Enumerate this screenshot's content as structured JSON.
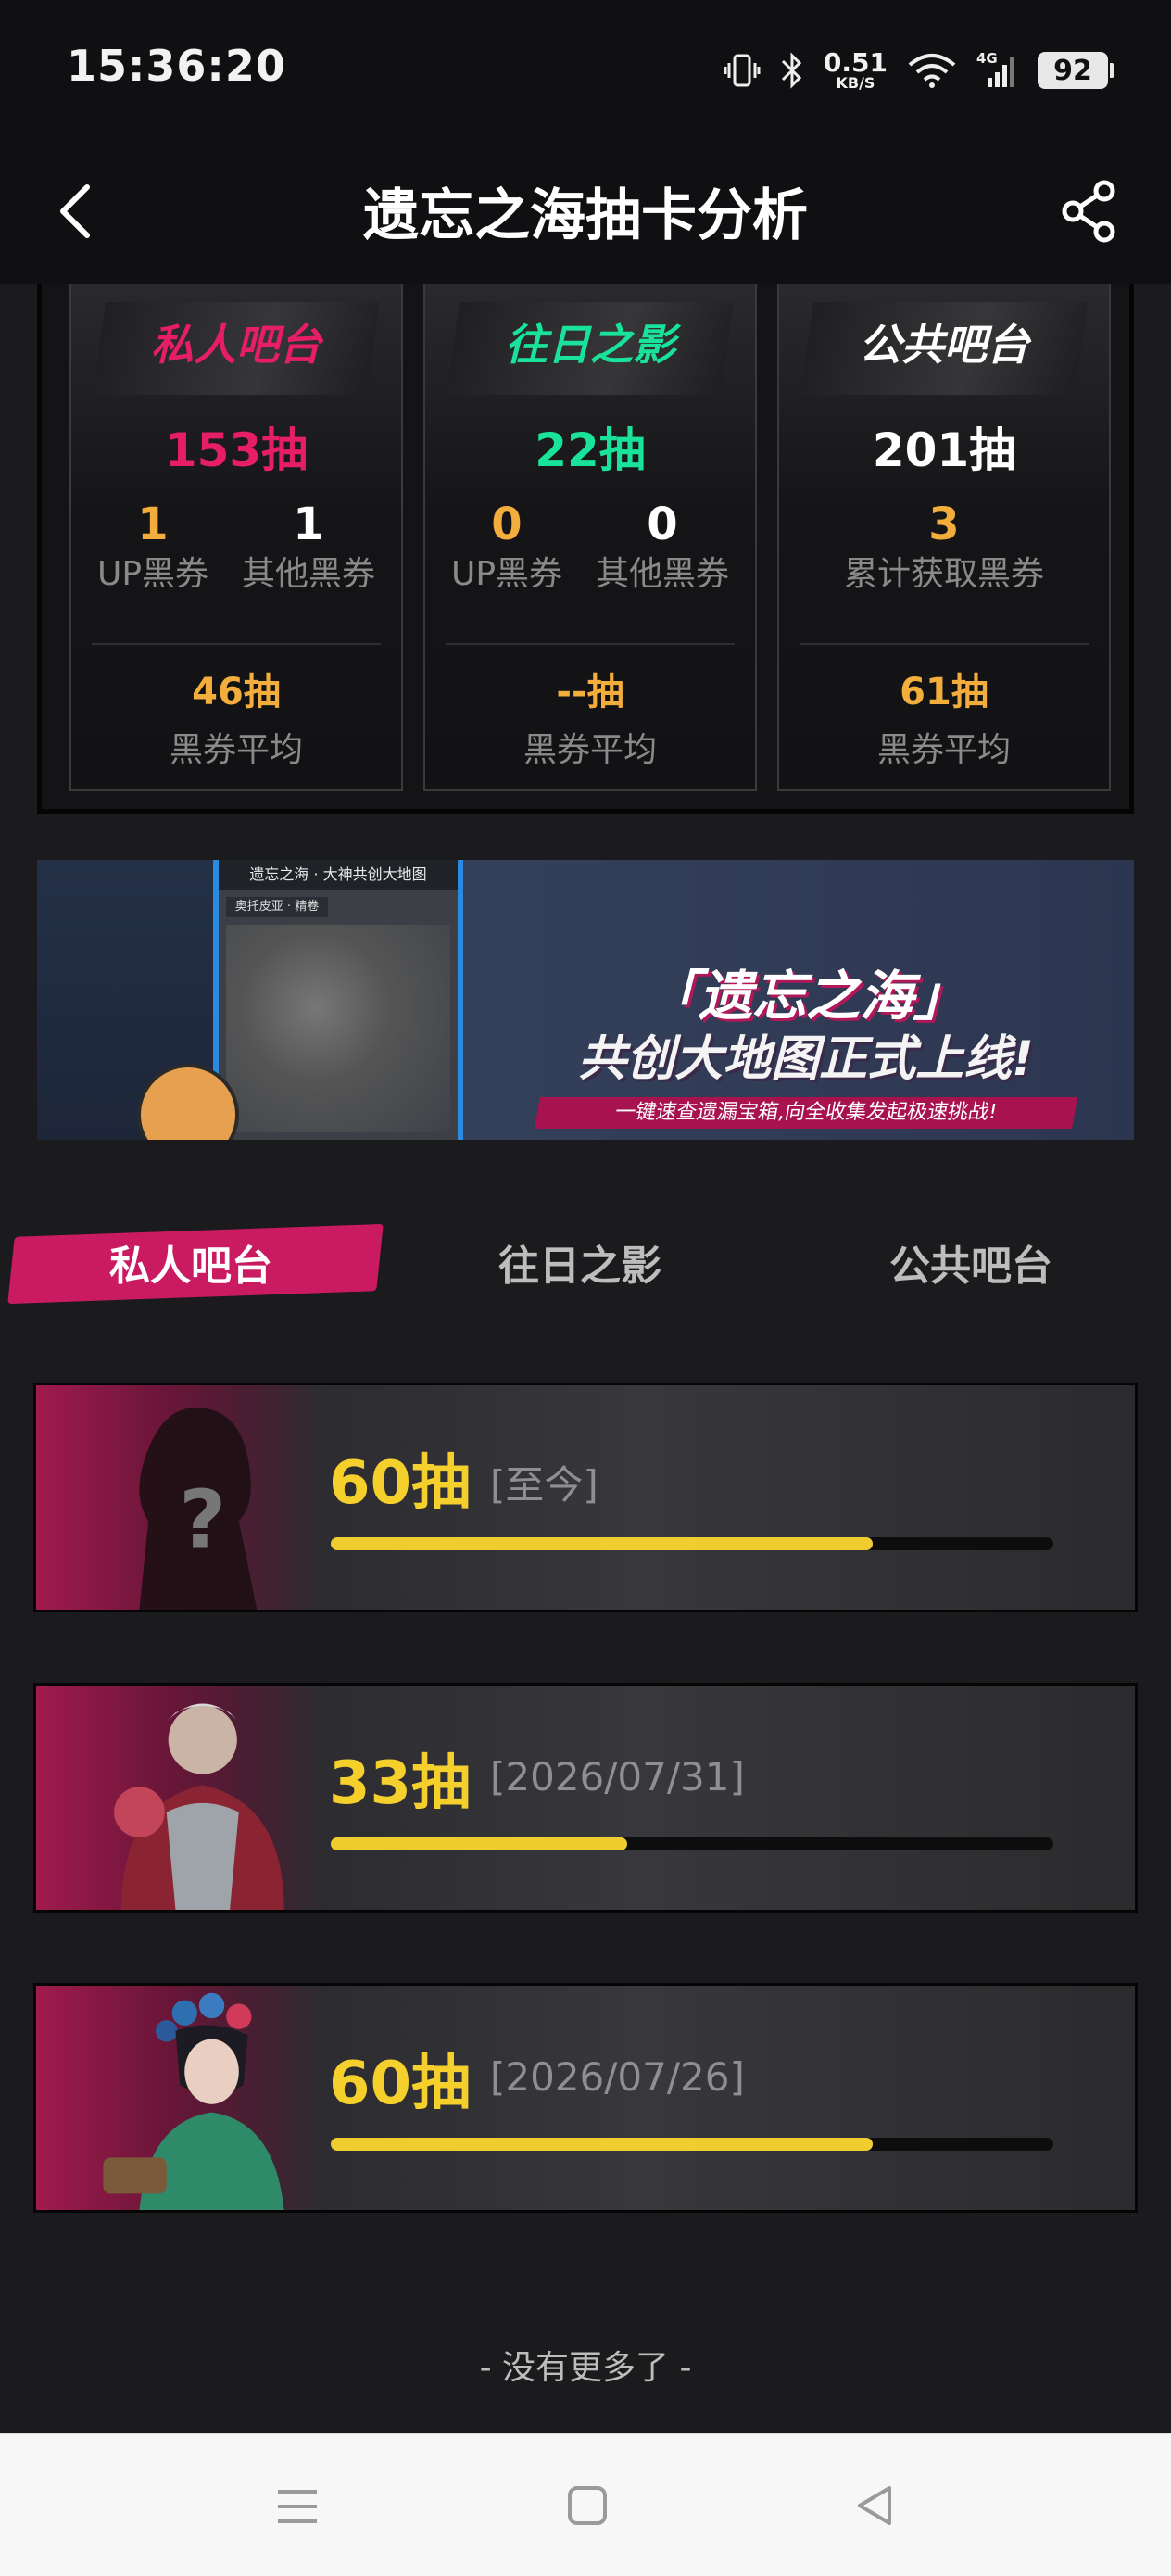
{
  "status_bar": {
    "time": "15:36:20",
    "net_speed": "0.51",
    "net_unit": "KB/S",
    "signal": "4G",
    "battery": "92"
  },
  "header": {
    "title": "遗忘之海抽卡分析"
  },
  "summary": {
    "cards": [
      {
        "name": "私人吧台",
        "count": "153抽",
        "color": "#e61e64",
        "a_num": "1",
        "a_label": "UP黑券",
        "b_num": "1",
        "b_label": "其他黑券",
        "avg": "46抽",
        "avg_label": "黑券平均"
      },
      {
        "name": "往日之影",
        "count": "22抽",
        "color": "#19e39a",
        "a_num": "0",
        "a_label": "UP黑券",
        "b_num": "0",
        "b_label": "其他黑券",
        "avg": "--抽",
        "avg_label": "黑券平均"
      },
      {
        "name": "公共吧台",
        "count": "201抽",
        "color": "#ffffff",
        "total_num": "3",
        "total_label": "累计获取黑券",
        "avg": "61抽",
        "avg_label": "黑券平均"
      }
    ]
  },
  "promo": {
    "phone_title": "遗忘之海 · 大神共创大地图",
    "phone_tab": "奥托皮亚 · 精卷",
    "title": "「遗忘之海」",
    "subtitle": "共创大地图正式上线!",
    "note": "一键速查遗漏宝箱,向全收集发起极速挑战!"
  },
  "tabs": [
    {
      "label": "私人吧台",
      "active": true
    },
    {
      "label": "往日之影",
      "active": false
    },
    {
      "label": "公共吧台",
      "active": false
    }
  ],
  "records": [
    {
      "count": "60抽",
      "date": "[至今]",
      "progress": 0.75
    },
    {
      "count": "33抽",
      "date": "[2026/07/31]",
      "progress": 0.41
    },
    {
      "count": "60抽",
      "date": "[2026/07/26]",
      "progress": 0.75
    }
  ],
  "footer": {
    "no_more": "- 没有更多了 -"
  },
  "colors": {
    "accent_pink": "#c91a62",
    "gold": "#f5cf2c",
    "orange": "#f3ad3c",
    "green": "#19e39a"
  }
}
